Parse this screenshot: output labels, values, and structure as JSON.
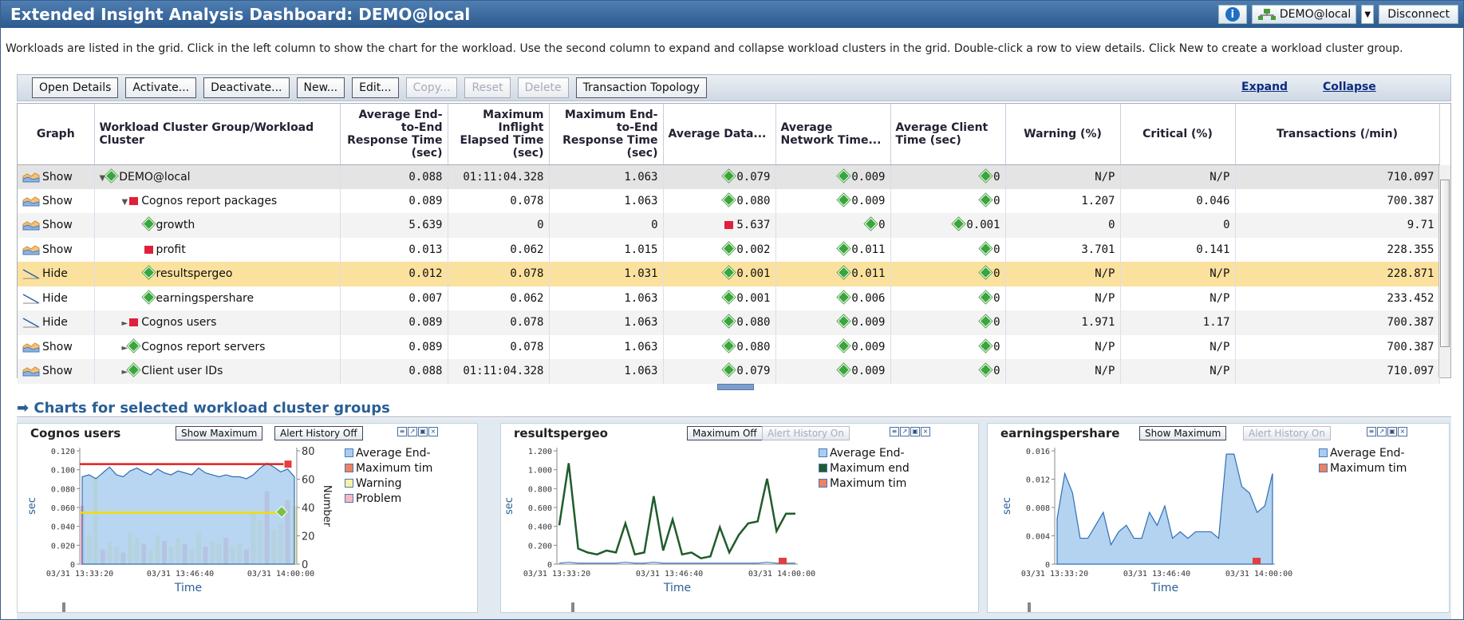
{
  "title": "Extended Insight Analysis Dashboard:  DEMO@local",
  "header": {
    "info_icon": "info-icon",
    "system_label": "DEMO@local",
    "disconnect_label": "Disconnect"
  },
  "description": "Workloads are listed in the grid. Click in the left column to show the chart for the workload. Use the second column to expand and collapse workload clusters in the grid. Double-click a row to view details. Click New to create a workload cluster group.",
  "toolbar": {
    "buttons": [
      "Open Details",
      "Activate...",
      "Deactivate...",
      "New...",
      "Edit...",
      "Copy...",
      "Reset",
      "Delete",
      "Transaction Topology"
    ],
    "expand": "Expand",
    "collapse": "Collapse"
  },
  "columns": [
    "Graph",
    "Workload Cluster Group/Workload Cluster",
    "Average End-to-End Response Time (sec)",
    "Maximum Inflight Elapsed Time (sec)",
    "Maximum End-to-End Response Time (sec)",
    "Average Data...",
    "Average Network Time...",
    "Average Client Time (sec)",
    "Warning (%)",
    "Critical (%)",
    "Transactions (/min)"
  ],
  "rows": [
    {
      "graph": "Show",
      "name": "DEMO@local",
      "avg_e2e": "0.088",
      "max_inflight": "01:11:04.328",
      "max_e2e": "1.063",
      "avg_data": "0.079",
      "avg_net": "0.009",
      "avg_client": "0",
      "warning": "N/P",
      "critical": "N/P",
      "tx": "710.097"
    },
    {
      "graph": "Show",
      "name": "Cognos report packages",
      "avg_e2e": "0.089",
      "max_inflight": "0.078",
      "max_e2e": "1.063",
      "avg_data": "0.080",
      "avg_net": "0.009",
      "avg_client": "0",
      "warning": "1.207",
      "critical": "0.046",
      "tx": "700.387"
    },
    {
      "graph": "Show",
      "name": "growth",
      "avg_e2e": "5.639",
      "max_inflight": "0",
      "max_e2e": "0",
      "avg_data": "5.637",
      "avg_net": "0",
      "avg_client": "0.001",
      "warning": "0",
      "critical": "0",
      "tx": "9.71"
    },
    {
      "graph": "Show",
      "name": "profit",
      "avg_e2e": "0.013",
      "max_inflight": "0.062",
      "max_e2e": "1.015",
      "avg_data": "0.002",
      "avg_net": "0.011",
      "avg_client": "0",
      "warning": "3.701",
      "critical": "0.141",
      "tx": "228.355"
    },
    {
      "graph": "Hide",
      "name": "resultspergeo",
      "avg_e2e": "0.012",
      "max_inflight": "0.078",
      "max_e2e": "1.031",
      "avg_data": "0.001",
      "avg_net": "0.011",
      "avg_client": "0",
      "warning": "N/P",
      "critical": "N/P",
      "tx": "228.871"
    },
    {
      "graph": "Hide",
      "name": "earningspershare",
      "avg_e2e": "0.007",
      "max_inflight": "0.062",
      "max_e2e": "1.063",
      "avg_data": "0.001",
      "avg_net": "0.006",
      "avg_client": "0",
      "warning": "N/P",
      "critical": "N/P",
      "tx": "233.452"
    },
    {
      "graph": "Hide",
      "name": "Cognos users",
      "avg_e2e": "0.089",
      "max_inflight": "0.078",
      "max_e2e": "1.063",
      "avg_data": "0.080",
      "avg_net": "0.009",
      "avg_client": "0",
      "warning": "1.971",
      "critical": "1.17",
      "tx": "700.387"
    },
    {
      "graph": "Show",
      "name": "Cognos report servers",
      "avg_e2e": "0.089",
      "max_inflight": "0.078",
      "max_e2e": "1.063",
      "avg_data": "0.080",
      "avg_net": "0.009",
      "avg_client": "0",
      "warning": "N/P",
      "critical": "N/P",
      "tx": "700.387"
    },
    {
      "graph": "Show",
      "name": "Client user IDs",
      "avg_e2e": "0.088",
      "max_inflight": "01:11:04.328",
      "max_e2e": "1.063",
      "avg_data": "0.079",
      "avg_net": "0.009",
      "avg_client": "0",
      "warning": "N/P",
      "critical": "N/P",
      "tx": "710.097"
    }
  ],
  "charts_header": "Charts for selected workload cluster groups",
  "panels": [
    {
      "title": "Cognos users",
      "btn1": "Show Maximum",
      "btn2": "Alert History Off",
      "legend": [
        "Average End-",
        "Maximum tim",
        "Warning",
        "Problem"
      ],
      "ylabel": "sec",
      "y2label": "Number",
      "xlabel": "Time",
      "xticks": [
        "03/31 13:33:20",
        "03/31 13:46:40",
        "03/31 14:00:00"
      ],
      "yticks": [
        "0.120",
        "0.100",
        "0.080",
        "0.060",
        "0.040",
        "0.020",
        "0"
      ],
      "y2ticks": [
        "80",
        "60",
        "40",
        "20",
        "0"
      ]
    },
    {
      "title": "resultspergeo",
      "btn1": "Maximum Off",
      "btn2": "Alert History On",
      "legend": [
        "Average End-",
        "Maximum end",
        "Maximum tim"
      ],
      "ylabel": "sec",
      "xlabel": "Time",
      "xticks": [
        "03/31 13:33:20",
        "03/31 13:46:40",
        "03/31 14:00:00"
      ],
      "yticks": [
        "1.200",
        "1.000",
        "0.800",
        "0.600",
        "0.400",
        "0.200",
        "0"
      ]
    },
    {
      "title": "earningspershare",
      "btn1": "Show Maximum",
      "btn2": "Alert History On",
      "legend": [
        "Average End-",
        "Maximum tim"
      ],
      "ylabel": "sec",
      "xlabel": "Time",
      "xticks": [
        "03/31 13:33:20",
        "03/31 13:46:40",
        "03/31 14:00:00"
      ],
      "yticks": [
        "0.016",
        "0.012",
        "0.008",
        "0.004",
        "0"
      ]
    }
  ],
  "chart_data": [
    {
      "type": "area",
      "title": "Cognos users",
      "ylabel": "sec",
      "ylim": [
        0,
        0.12
      ],
      "xlabel": "Time",
      "series": [
        {
          "name": "Average End-",
          "values": [
            0.09,
            0.092,
            0.088,
            0.094,
            0.1,
            0.092,
            0.09,
            0.096,
            0.099,
            0.095,
            0.092,
            0.098,
            0.094,
            0.092,
            0.096,
            0.094,
            0.092,
            0.099,
            0.094,
            0.092,
            0.09,
            0.092,
            0.09,
            0.09,
            0.088,
            0.092,
            0.099,
            0.104,
            0.1,
            0.095,
            0.098,
            0.09
          ]
        },
        {
          "name": "Warning",
          "values": [
            40,
            20,
            60,
            10,
            15,
            12,
            8,
            22,
            18,
            14,
            10,
            20,
            16,
            12,
            18,
            14,
            10,
            22,
            12,
            16,
            14,
            18,
            12,
            14,
            10,
            36,
            30,
            50,
            24,
            28,
            44,
            40
          ]
        }
      ],
      "thresholds": {
        "red": 0.103,
        "yellow": 0.053
      }
    },
    {
      "type": "line",
      "title": "resultspergeo",
      "ylabel": "sec",
      "ylim": [
        0,
        1.2
      ],
      "xlabel": "Time",
      "series": [
        {
          "name": "Maximum end",
          "values": [
            0.4,
            1.04,
            0.16,
            0.12,
            0.1,
            0.14,
            0.12,
            0.42,
            0.1,
            0.12,
            0.7,
            0.14,
            0.46,
            0.1,
            0.12,
            0.06,
            0.08,
            0.38,
            0.12,
            0.3,
            0.42,
            0.44,
            0.88,
            0.34,
            0.52,
            0.52
          ]
        },
        {
          "name": "Average End-",
          "values": [
            0.01,
            0.02,
            0.01,
            0.01,
            0.01,
            0.01,
            0.01,
            0.02,
            0.01,
            0.01,
            0.02,
            0.01,
            0.01,
            0.01,
            0.01,
            0.01,
            0.01,
            0.01,
            0.01,
            0.01,
            0.01,
            0.01,
            0.02,
            0.01,
            0.01,
            0.01
          ]
        }
      ]
    },
    {
      "type": "area",
      "title": "earningspershare",
      "ylabel": "sec",
      "ylim": [
        0,
        0.018
      ],
      "xlabel": "Time",
      "series": [
        {
          "name": "Average End-",
          "values": [
            0.007,
            0.014,
            0.011,
            0.004,
            0.004,
            0.006,
            0.008,
            0.003,
            0.005,
            0.006,
            0.004,
            0.004,
            0.008,
            0.006,
            0.009,
            0.004,
            0.005,
            0.004,
            0.005,
            0.005,
            0.005,
            0.004,
            0.017,
            0.017,
            0.012,
            0.011,
            0.008,
            0.009,
            0.014
          ]
        }
      ]
    }
  ]
}
